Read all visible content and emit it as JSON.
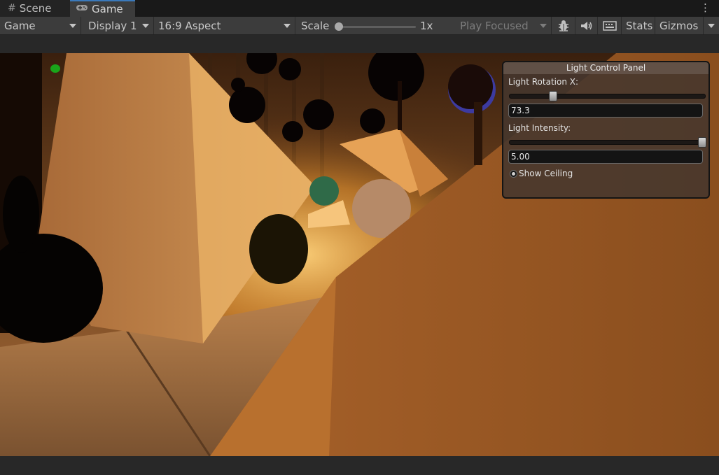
{
  "tabs": [
    {
      "label": "Scene",
      "icon": "grid-icon"
    },
    {
      "label": "Game",
      "icon": "gamepad-icon",
      "active": true
    }
  ],
  "toolbar": {
    "display_mode": "Game",
    "display": "Display 1",
    "aspect": "16:9 Aspect",
    "scale_label": "Scale",
    "scale_value": "1x",
    "scale_level": 0,
    "play_mode": "Play Focused",
    "stats_label": "Stats",
    "gizmos_label": "Gizmos"
  },
  "panel": {
    "title": "Light Control Panel",
    "rotation_label": "Light Rotation X:",
    "rotation_value": "73.3",
    "rotation_level": 0.2,
    "intensity_label": "Light Intensity:",
    "intensity_value": "5.00",
    "intensity_level": 1.0,
    "toggle_label": "Show Ceiling"
  },
  "colors": {
    "accent_tab": "#3a79bb",
    "panel_bg": "#46372e",
    "scene_light": "#ffb23a"
  }
}
